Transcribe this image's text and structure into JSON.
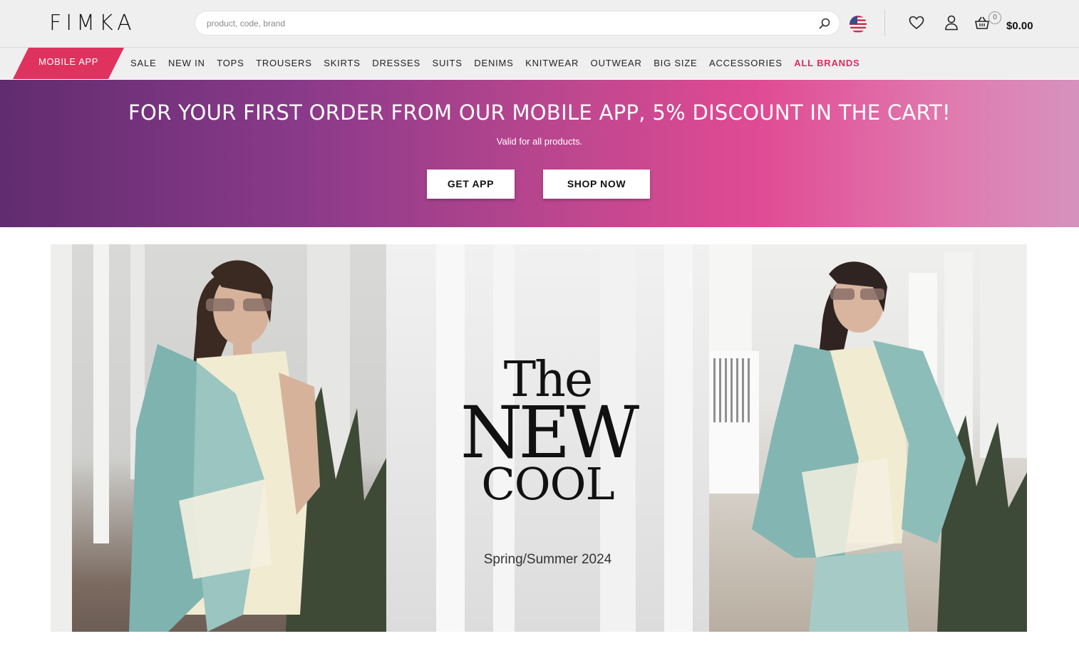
{
  "header": {
    "logo": "FIMKA",
    "search_placeholder": "product, code, brand",
    "cart_count": "0",
    "cart_total": "$0.00"
  },
  "nav": {
    "mobile_app": "MOBILE APP",
    "items": [
      "SALE",
      "NEW IN",
      "TOPS",
      "TROUSERS",
      "SKIRTS",
      "DRESSES",
      "SUITS",
      "DENIMS",
      "KNITWEAR",
      "OUTWEAR",
      "BIG SIZE",
      "ACCESSORIES",
      "ALL BRANDS"
    ]
  },
  "promo": {
    "title": "FOR YOUR FIRST ORDER FROM OUR MOBILE APP, 5% DISCOUNT IN THE CART!",
    "subtitle": "Valid for all products.",
    "get_app": "GET APP",
    "shop_now": "SHOP NOW"
  },
  "hero": {
    "line1": "The",
    "line2": "NEW",
    "line3": "COOL",
    "season": "Spring/Summer 2024"
  },
  "colors": {
    "accent": "#e0325f",
    "brands": "#d62e63",
    "promo_start": "#612c70",
    "promo_end": "#d692bd"
  },
  "icons": [
    "search-icon",
    "us-flag-icon",
    "heart-icon",
    "user-icon",
    "basket-icon"
  ]
}
